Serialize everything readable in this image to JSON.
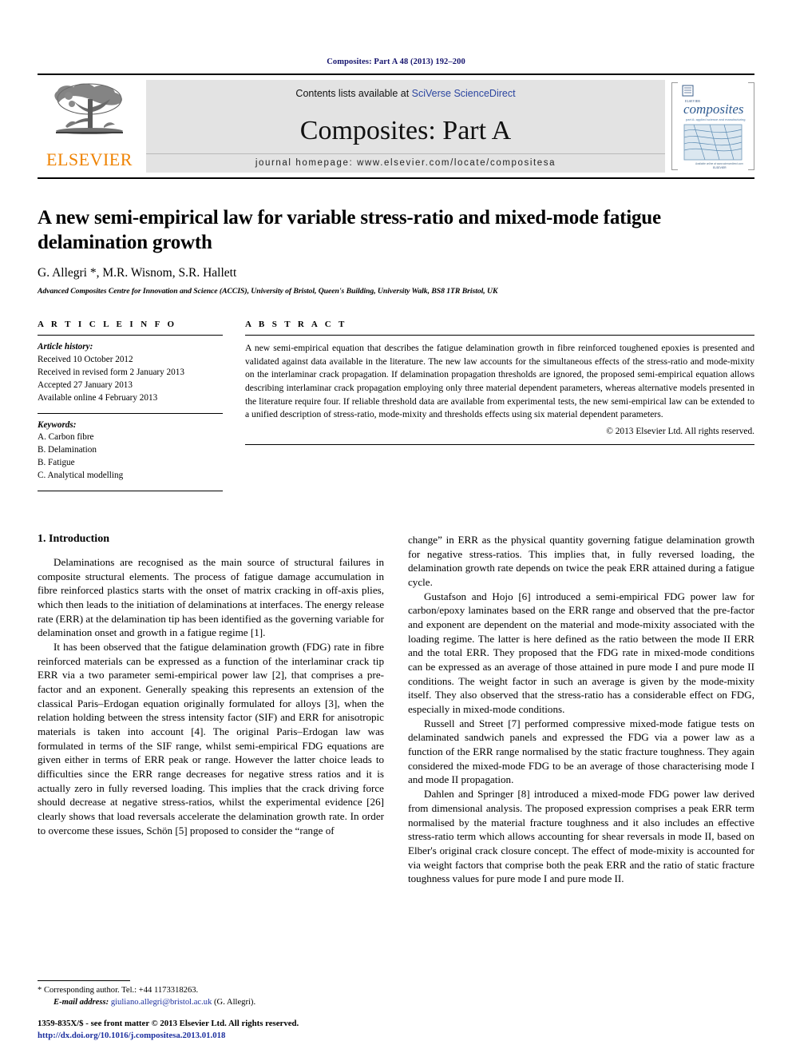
{
  "running_head": "Composites: Part A 48 (2013) 192–200",
  "masthead": {
    "publisher_name": "ELSEVIER",
    "contents_prefix": "Contents lists available at ",
    "contents_link": "SciVerse ScienceDirect",
    "journal_title": "Composites: Part A",
    "homepage": "journal homepage: www.elsevier.com/locate/compositesa",
    "cover_title": "composites",
    "cover_subtitle": "part A: applied science and manufacturing"
  },
  "article": {
    "title": "A new semi-empirical law for variable stress-ratio and mixed-mode fatigue delamination growth",
    "authors": "G. Allegri *, M.R. Wisnom, S.R. Hallett",
    "affiliation": "Advanced Composites Centre for Innovation and Science (ACCIS), University of Bristol, Queen's Building, University Walk, BS8 1TR Bristol, UK"
  },
  "info": {
    "heading": "A R T I C L E   I N F O",
    "history_label": "Article history:",
    "history": [
      "Received 10 October 2012",
      "Received in revised form 2 January 2013",
      "Accepted 27 January 2013",
      "Available online 4 February 2013"
    ],
    "keywords_label": "Keywords:",
    "keywords": [
      "A. Carbon fibre",
      "B. Delamination",
      "B. Fatigue",
      "C. Analytical modelling"
    ]
  },
  "abstract": {
    "heading": "A B S T R A C T",
    "text": "A new semi-empirical equation that describes the fatigue delamination growth in fibre reinforced toughened epoxies is presented and validated against data available in the literature. The new law accounts for the simultaneous effects of the stress-ratio and mode-mixity on the interlaminar crack propagation. If delamination propagation thresholds are ignored, the proposed semi-empirical equation allows describing interlaminar crack propagation employing only three material dependent parameters, whereas alternative models presented in the literature require four. If reliable threshold data are available from experimental tests, the new semi-empirical law can be extended to a unified description of stress-ratio, mode-mixity and thresholds effects using six material dependent parameters.",
    "copyright": "© 2013 Elsevier Ltd. All rights reserved."
  },
  "body": {
    "section_heading": "1. Introduction",
    "left_paragraphs": [
      "Delaminations are recognised as the main source of structural failures in composite structural elements. The process of fatigue damage accumulation in fibre reinforced plastics starts with the onset of matrix cracking in off-axis plies, which then leads to the initiation of delaminations at interfaces. The energy release rate (ERR) at the delamination tip has been identified as the governing variable for delamination onset and growth in a fatigue regime [1].",
      "It has been observed that the fatigue delamination growth (FDG) rate in fibre reinforced materials can be expressed as a function of the interlaminar crack tip ERR via a two parameter semi-empirical power law [2], that comprises a pre-factor and an exponent. Generally speaking this represents an extension of the classical Paris–Erdogan equation originally formulated for alloys [3], when the relation holding between the stress intensity factor (SIF) and ERR for anisotropic materials is taken into account [4]. The original Paris–Erdogan law was formulated in terms of the SIF range, whilst semi-empirical FDG equations are given either in terms of ERR peak or range. However the latter choice leads to difficulties since the ERR range decreases for negative stress ratios and it is actually zero in fully reversed loading. This implies that the crack driving force should decrease at negative stress-ratios, whilst the experimental evidence [26] clearly shows that load reversals accelerate the delamination growth rate. In order to overcome these issues, Schön [5] proposed to consider the “range of"
    ],
    "right_paragraphs": [
      "change” in ERR as the physical quantity governing fatigue delamination growth for negative stress-ratios. This implies that, in fully reversed loading, the delamination growth rate depends on twice the peak ERR attained during a fatigue cycle.",
      "Gustafson and Hojo [6] introduced a semi-empirical FDG power law for carbon/epoxy laminates based on the ERR range and observed that the pre-factor and exponent are dependent on the material and mode-mixity associated with the loading regime. The latter is here defined as the ratio between the mode II ERR and the total ERR. They proposed that the FDG rate in mixed-mode conditions can be expressed as an average of those attained in pure mode I and pure mode II conditions. The weight factor in such an average is given by the mode-mixity itself. They also observed that the stress-ratio has a considerable effect on FDG, especially in mixed-mode conditions.",
      "Russell and Street [7] performed compressive mixed-mode fatigue tests on delaminated sandwich panels and expressed the FDG via a power law as a function of the ERR range normalised by the static fracture toughness. They again considered the mixed-mode FDG to be an average of those characterising mode I and mode II propagation.",
      "Dahlen and Springer [8] introduced a mixed-mode FDG power law derived from dimensional analysis. The proposed expression comprises a peak ERR term normalised by the material fracture toughness and it also includes an effective stress-ratio term which allows accounting for shear reversals in mode II, based on Elber's original crack closure concept. The effect of mode-mixity is accounted for via weight factors that comprise both the peak ERR and the ratio of static fracture toughness values for pure mode I and pure mode II."
    ]
  },
  "footnote": {
    "corresponding": "* Corresponding author. Tel.: +44 1173318263.",
    "email_label": "E-mail address:",
    "email": "giuliano.allegri@bristol.ac.uk",
    "email_suffix": "(G. Allegri)."
  },
  "imprint": {
    "line1": "1359-835X/$ - see front matter © 2013 Elsevier Ltd. All rights reserved.",
    "doi": "http://dx.doi.org/10.1016/j.compositesa.2013.01.018"
  },
  "colors": {
    "running_head": "#15146e",
    "link": "#1c2f9e",
    "elsevier_orange": "#ef8200",
    "masthead_grey": "#e3e3e3"
  }
}
